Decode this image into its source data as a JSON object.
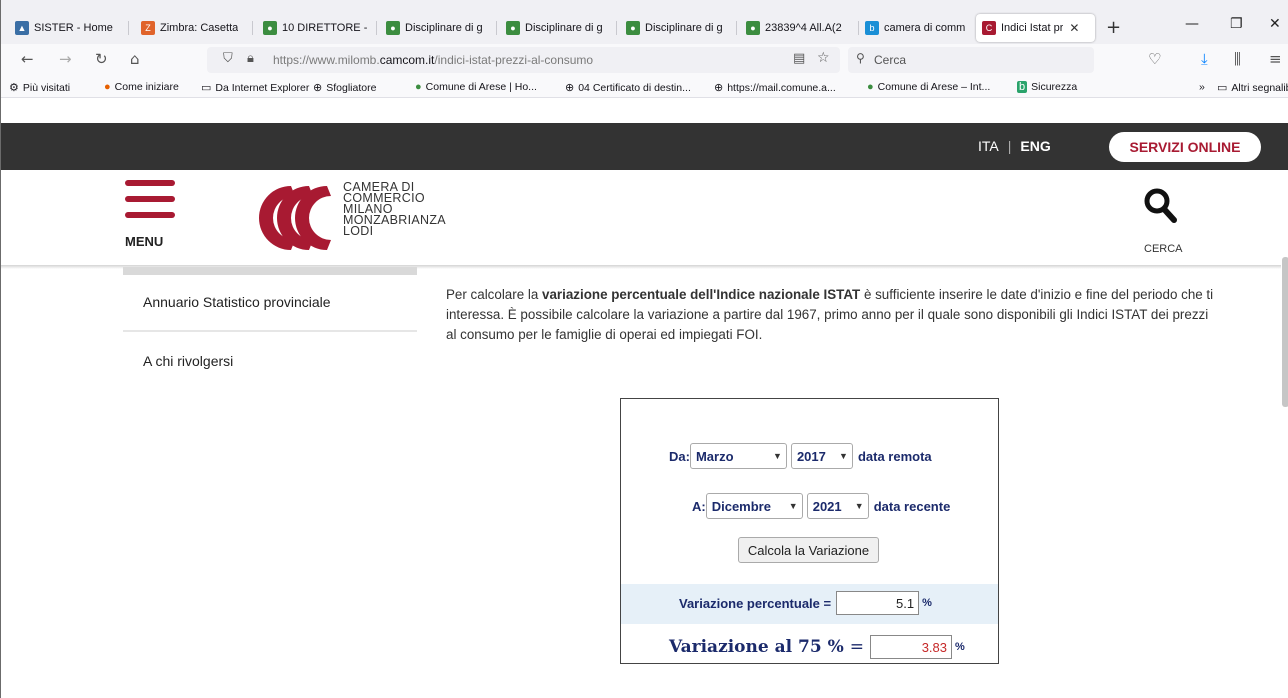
{
  "browser": {
    "tabs": [
      {
        "title": "SISTER - Home",
        "icon": "sister-icon",
        "color": "#3a6ea5"
      },
      {
        "title": "Zimbra: Casetta",
        "icon": "zimbra-icon",
        "color": "#e0632a"
      },
      {
        "title": "10 DIRETTORE -",
        "icon": "comune-icon",
        "color": "#3c8d40"
      },
      {
        "title": "Disciplinare di g",
        "icon": "comune-icon",
        "color": "#3c8d40"
      },
      {
        "title": "Disciplinare di g",
        "icon": "comune-icon",
        "color": "#3c8d40"
      },
      {
        "title": "Disciplinare di g",
        "icon": "comune-icon",
        "color": "#3c8d40"
      },
      {
        "title": "23839^4 All.A(2",
        "icon": "comune-icon",
        "color": "#3c8d40"
      },
      {
        "title": "camera di comm",
        "icon": "bing-icon",
        "color": "#1a8fd6"
      },
      {
        "title": "Indici Istat pr",
        "icon": "camcom-icon",
        "color": "#a81a32",
        "active": true
      }
    ],
    "url_prefix": "https://www.milomb.",
    "url_domain": "camcom.it",
    "url_path": "/indici-istat-prezzi-al-consumo",
    "search_placeholder": "Cerca",
    "bookmarks": [
      {
        "label": "Più visitati",
        "icon": "gear-icon"
      },
      {
        "label": "Come iniziare",
        "icon": "firefox-icon"
      },
      {
        "label": "Da Internet Explorer",
        "icon": "folder-icon"
      },
      {
        "label": "Sfogliatore",
        "icon": "globe-icon"
      },
      {
        "label": "Comune di Arese | Ho...",
        "icon": "comune-icon"
      },
      {
        "label": "04 Certificato di destin...",
        "icon": "globe-icon"
      },
      {
        "label": "https://mail.comune.a...",
        "icon": "globe-icon"
      },
      {
        "label": "Comune di Arese – Int...",
        "icon": "comune-icon"
      },
      {
        "label": "Sicurezza",
        "icon": "bing-icon"
      }
    ],
    "other_bookmarks": "Altri segnalibri"
  },
  "site": {
    "lang_ita": "ITA",
    "lang_eng": "ENG",
    "servizi_online": "SERVIZI ONLINE",
    "menu_label": "MENU",
    "logo_lines": [
      "CAMERA DI",
      "COMMERCIO",
      "MILANO",
      "MONZABRIANZA",
      "LODI"
    ],
    "search_label": "CERCA",
    "brand_color": "#a81a32"
  },
  "sidebar": {
    "items": [
      "Annuario Statistico provinciale",
      "A chi rivolgersi"
    ]
  },
  "intro": {
    "part1": "Per calcolare la ",
    "bold1": "variazione percentuale dell'Indice nazionale ISTAT",
    "part2": " è sufficiente inserire le date d'inizio e fine del periodo che ti interessa. È possibile calcolare la variazione a partire dal 1967, primo anno per il quale sono disponibili gli Indici ISTAT dei prezzi al consumo per le famiglie di operai ed impiegati FOI."
  },
  "calculator": {
    "from_label": "Da:",
    "from_month": "Marzo",
    "from_year": "2017",
    "from_note": "data remota",
    "to_label": "A:",
    "to_month": "Dicembre",
    "to_year": "2021",
    "to_note": "data recente",
    "button": "Calcola la Variazione",
    "var_label": "Variazione percentuale =",
    "var_value": "5.1",
    "var_unit": "%",
    "var75_label": "Variazione al 75 %",
    "var75_eq": "=",
    "var75_value": "3.83",
    "var75_unit": "%"
  }
}
